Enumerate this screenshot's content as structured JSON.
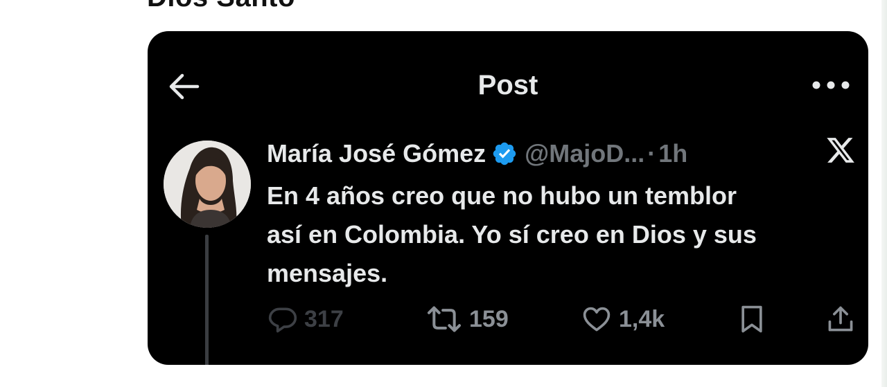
{
  "page": {
    "cut_heading": "Dios Santo"
  },
  "header": {
    "back_icon": "arrow-left-icon",
    "title": "Post",
    "more_icon": "more-horizontal-icon"
  },
  "post": {
    "author_name": "María José Gómez",
    "verified_icon": "verified-badge-icon",
    "verified_color": "#1d9bf0",
    "handle": "@MajoD...",
    "separator": "·",
    "time": "1h",
    "platform_logo": "x-logo",
    "text_lines": [
      "En 4 años creo que no hubo un temblor",
      "así en Colombia. Yo sí creo en Dios y sus",
      "mensajes."
    ]
  },
  "actions": {
    "replies": "317",
    "reposts": "159",
    "likes": "1,4k"
  }
}
